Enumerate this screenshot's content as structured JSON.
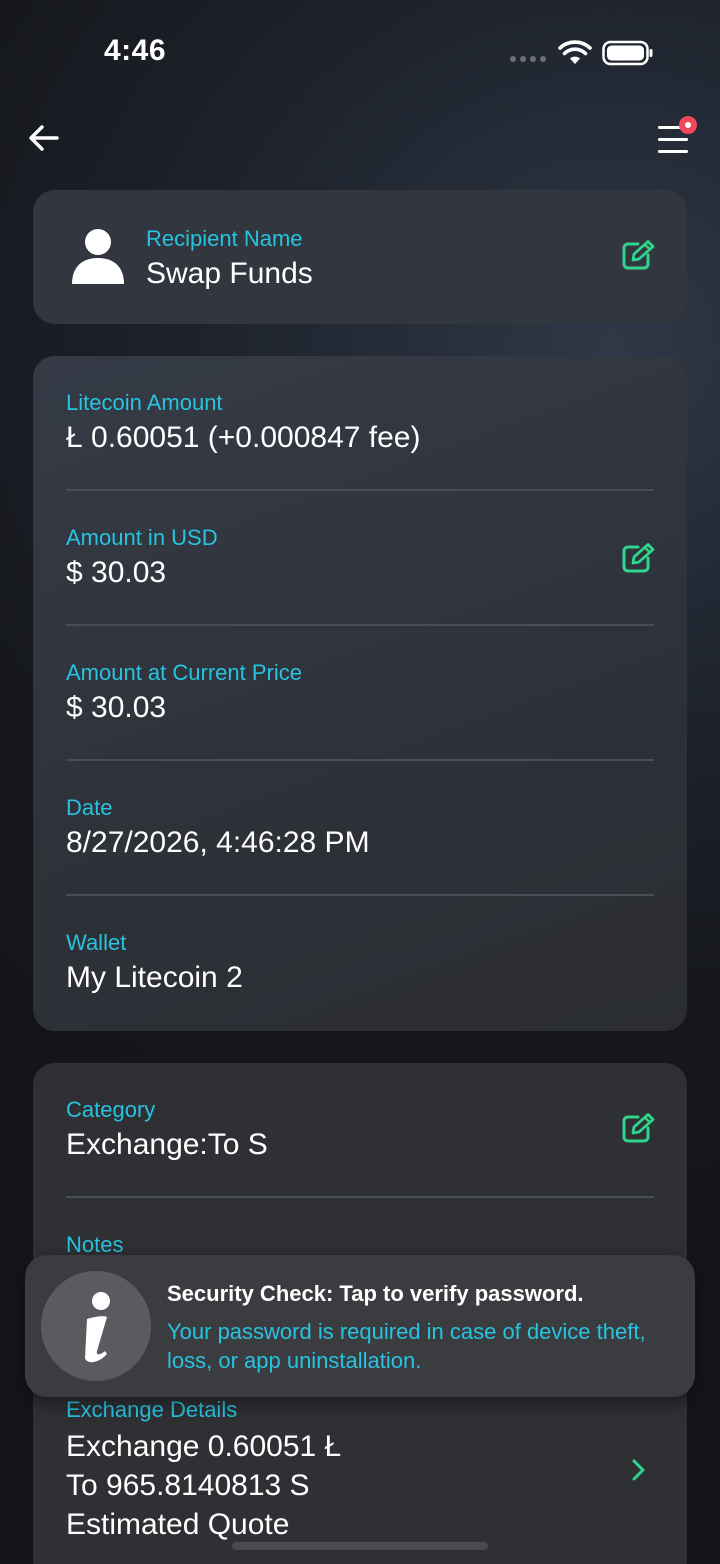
{
  "status_bar": {
    "time": "4:46"
  },
  "recipient": {
    "label": "Recipient Name",
    "value": "Swap Funds"
  },
  "details": [
    {
      "label": "Litecoin Amount",
      "value": "Ł 0.60051 (+0.000847 fee)",
      "editable": false
    },
    {
      "label": "Amount in USD",
      "value": "$ 30.03",
      "editable": true
    },
    {
      "label": "Amount at Current Price",
      "value": "$ 30.03",
      "editable": false
    },
    {
      "label": "Date",
      "value": "8/27/2026, 4:46:28 PM",
      "editable": false
    },
    {
      "label": "Wallet",
      "value": "My Litecoin 2",
      "editable": false
    }
  ],
  "category": {
    "label": "Category",
    "value": "Exchange:To S"
  },
  "notes": {
    "label": "Notes"
  },
  "exchange": {
    "label": "Exchange Details",
    "line1": "Exchange 0.60051 Ł",
    "line2": "To 965.8140813 S",
    "line3": "Estimated Quote"
  },
  "toast": {
    "title": "Security Check: Tap to verify password.",
    "body": "Your password is required in case of device theft, loss, or app uninstallation."
  },
  "colors": {
    "accent_label": "#27c3e0",
    "edit_icon": "#2fd58c",
    "notification_dot": "#f0475b"
  },
  "icons": {
    "back": "arrow-left-icon",
    "menu": "hamburger-menu-icon",
    "recipient": "user-icon",
    "edit": "edit-icon",
    "toast": "info-icon",
    "exchange": "chevron-right-icon"
  }
}
